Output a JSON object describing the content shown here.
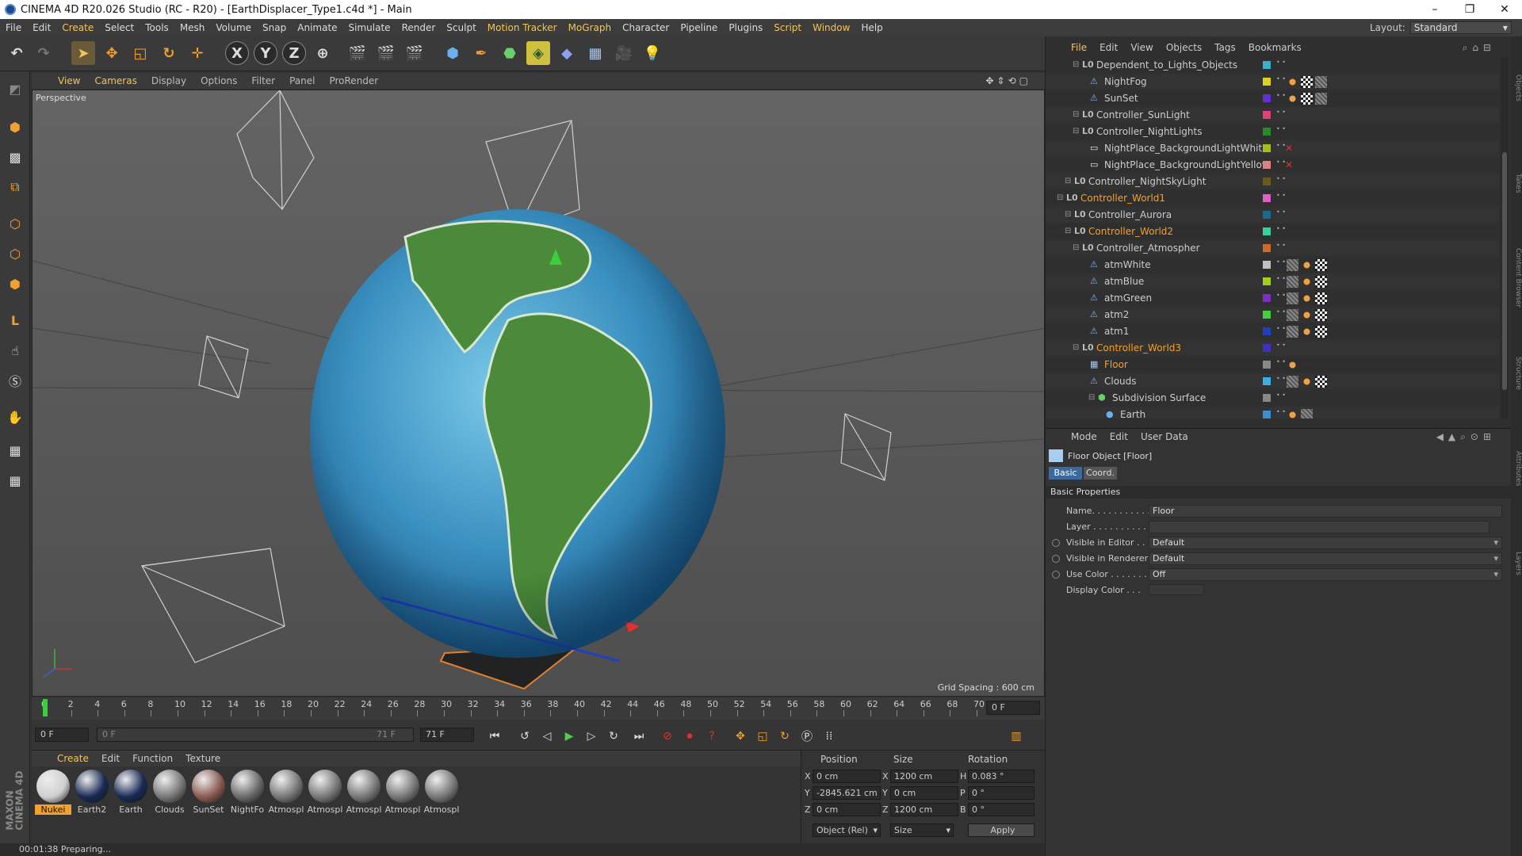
{
  "window": {
    "title": "CINEMA 4D R20.026 Studio (RC - R20) - [EarthDisplacer_Type1.c4d *] - Main",
    "controls": [
      "–",
      "❐",
      "✕"
    ]
  },
  "menu": {
    "items": [
      "File",
      "Edit",
      "Create",
      "Select",
      "Tools",
      "Mesh",
      "Volume",
      "Snap",
      "Animate",
      "Simulate",
      "Render",
      "Sculpt",
      "Motion Tracker",
      "MoGraph",
      "Character",
      "Pipeline",
      "Plugins",
      "Script",
      "Window",
      "Help"
    ],
    "layout_label": "Layout:",
    "layout_value": "Standard"
  },
  "toolbar": {
    "axis_x": "X",
    "axis_y": "Y",
    "axis_z": "Z"
  },
  "viewport": {
    "menu": [
      "View",
      "Cameras",
      "Display",
      "Options",
      "Filter",
      "Panel",
      "ProRender"
    ],
    "label": "Perspective",
    "grid_spacing": "Grid Spacing : 600 cm"
  },
  "timeline": {
    "ticks": [
      "0",
      "2",
      "4",
      "6",
      "8",
      "10",
      "12",
      "14",
      "16",
      "18",
      "20",
      "22",
      "24",
      "26",
      "28",
      "30",
      "32",
      "34",
      "36",
      "38",
      "40",
      "42",
      "44",
      "46",
      "48",
      "50",
      "52",
      "54",
      "56",
      "58",
      "60",
      "62",
      "64",
      "66",
      "68",
      "70"
    ],
    "current_frame": "0 F",
    "start_field": "0 F",
    "range_start": "0 F",
    "range_end": "71 F",
    "end_field": "71 F"
  },
  "materials": {
    "menu": [
      "Create",
      "Edit",
      "Function",
      "Texture"
    ],
    "items": [
      {
        "name": "Nukei",
        "color": "#cfcfcf"
      },
      {
        "name": "Earth2",
        "color": "#1a2a55"
      },
      {
        "name": "Earth",
        "color": "#1a2a55"
      },
      {
        "name": "Clouds",
        "color": "#777777"
      },
      {
        "name": "SunSet",
        "color": "#8a5a50"
      },
      {
        "name": "NightFo",
        "color": "#6a6a6a"
      },
      {
        "name": "Atmospl",
        "color": "#777777"
      },
      {
        "name": "Atmospl",
        "color": "#777777"
      },
      {
        "name": "Atmospl",
        "color": "#777777"
      },
      {
        "name": "Atmospl",
        "color": "#777777"
      },
      {
        "name": "Atmospl",
        "color": "#777777"
      }
    ]
  },
  "coords": {
    "headers": [
      "Position",
      "Size",
      "Rotation"
    ],
    "rows": [
      {
        "axis": "X",
        "pos": "0 cm",
        "size_axis": "X",
        "size": "1200 cm",
        "rot_axis": "H",
        "rot": "0.083 °"
      },
      {
        "axis": "Y",
        "pos": "-2845.621 cm",
        "size_axis": "Y",
        "size": "0 cm",
        "rot_axis": "P",
        "rot": "0 °"
      },
      {
        "axis": "Z",
        "pos": "0 cm",
        "size_axis": "Z",
        "size": "1200 cm",
        "rot_axis": "B",
        "rot": "0 °"
      }
    ],
    "mode_select": "Object (Rel)",
    "size_select": "Size",
    "apply": "Apply"
  },
  "status": "00:01:38 Preparing...",
  "objects": {
    "menu": [
      "File",
      "Edit",
      "View",
      "Objects",
      "Tags",
      "Bookmarks"
    ],
    "rows": [
      {
        "name": "Dependent_to_Lights_Objects",
        "indent": 3,
        "color": "#3ab0d0",
        "type": "null",
        "hl": false
      },
      {
        "name": "NightFog",
        "indent": 4,
        "color": "#e0d020",
        "type": "light",
        "hl": false
      },
      {
        "name": "SunSet",
        "indent": 4,
        "color": "#6030d0",
        "type": "light",
        "hl": false
      },
      {
        "name": "Controller_SunLight",
        "indent": 3,
        "color": "#e04080",
        "type": "null",
        "hl": false
      },
      {
        "name": "Controller_NightLights",
        "indent": 3,
        "color": "#2a8a2a",
        "type": "null",
        "hl": false
      },
      {
        "name": "NightPlace_BackgroundLightWhite",
        "indent": 4,
        "color": "#a0c020",
        "type": "obj",
        "hl": false
      },
      {
        "name": "NightPlace_BackgroundLightYellow",
        "indent": 4,
        "color": "#e08080",
        "type": "obj",
        "hl": false
      },
      {
        "name": "Controller_NightSkyLight",
        "indent": 2,
        "color": "#6a5a20",
        "type": "null",
        "hl": false
      },
      {
        "name": "Controller_World1",
        "indent": 1,
        "color": "#e060c0",
        "type": "null",
        "hl": true
      },
      {
        "name": "Controller_Aurora",
        "indent": 2,
        "color": "#1a6a8a",
        "type": "null",
        "hl": false
      },
      {
        "name": "Controller_World2",
        "indent": 2,
        "color": "#3ad09a",
        "type": "null",
        "hl": true
      },
      {
        "name": "Controller_Atmospher",
        "indent": 3,
        "color": "#d06a2a",
        "type": "null",
        "hl": false
      },
      {
        "name": "atmWhite",
        "indent": 4,
        "color": "#c0c0c0",
        "type": "light",
        "hl": false
      },
      {
        "name": "atmBlue",
        "indent": 4,
        "color": "#a0d020",
        "type": "light",
        "hl": false
      },
      {
        "name": "atmGreen",
        "indent": 4,
        "color": "#7a30c0",
        "type": "light",
        "hl": false
      },
      {
        "name": "atm2",
        "indent": 4,
        "color": "#40d040",
        "type": "light",
        "hl": false
      },
      {
        "name": "atm1",
        "indent": 4,
        "color": "#2040c0",
        "type": "light",
        "hl": false
      },
      {
        "name": "Controller_World3",
        "indent": 3,
        "color": "#4030c0",
        "type": "null",
        "hl": true
      },
      {
        "name": "Floor",
        "indent": 4,
        "color": "#888888",
        "type": "floor",
        "hl": true
      },
      {
        "name": "Clouds",
        "indent": 4,
        "color": "#3ab0e0",
        "type": "light",
        "hl": false
      },
      {
        "name": "Subdivision Surface",
        "indent": 5,
        "color": "#888888",
        "type": "subd",
        "hl": false
      },
      {
        "name": "Earth",
        "indent": 6,
        "color": "#3a90d0",
        "type": "sphere",
        "hl": false
      }
    ]
  },
  "attributes": {
    "menu": [
      "Mode",
      "Edit",
      "User Data"
    ],
    "object_title": "Floor Object [Floor]",
    "tabs": [
      "Basic",
      "Coord."
    ],
    "section": "Basic Properties",
    "fields": [
      {
        "label": "Name. . . . . . . . . . . .",
        "value": "Floor",
        "dropdown": false,
        "radio": false
      },
      {
        "label": "Layer . . . . . . . . . . .",
        "value": "",
        "dropdown": false,
        "radio": false
      },
      {
        "label": "Visible in Editor . . .",
        "value": "Default",
        "dropdown": true,
        "radio": true
      },
      {
        "label": "Visible in Renderer",
        "value": "Default",
        "dropdown": true,
        "radio": true
      },
      {
        "label": "Use Color . . . . . . . .",
        "value": "Off",
        "dropdown": true,
        "radio": true
      },
      {
        "label": "Display Color . . .",
        "value": "",
        "dropdown": false,
        "radio": false
      }
    ]
  },
  "side_tabs": [
    "Objects",
    "Takes",
    "Content Browser",
    "Structure",
    "Attributes",
    "Layers"
  ]
}
